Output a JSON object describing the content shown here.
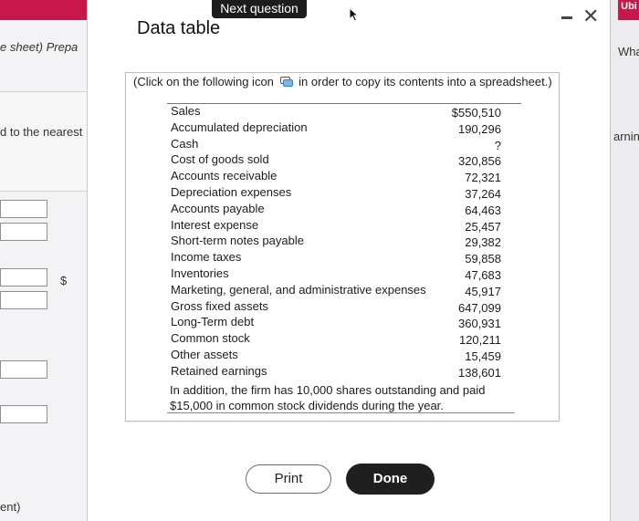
{
  "background": {
    "left_text_1": "e sheet) Prepa",
    "left_text_2": "d to the nearest",
    "left_dollar": "$",
    "left_text_3": "ent)",
    "right_text_1": "Wha",
    "right_text_2": "arnin",
    "right_badge": "Ubi"
  },
  "tooltip": "Next question",
  "window_title": "Data table",
  "window_controls": {
    "minimize": "minimize-icon",
    "close": "close-icon"
  },
  "instruction": {
    "before": "(Click on the following icon",
    "icon": "copy-icon",
    "after": "in order to copy its contents into a spreadsheet.)"
  },
  "table": {
    "rows": [
      {
        "label": "Sales",
        "value": "$550,510"
      },
      {
        "label": "Accumulated depreciation",
        "value": "190,296"
      },
      {
        "label": "Cash",
        "value": "?"
      },
      {
        "label": "Cost of goods sold",
        "value": "320,856"
      },
      {
        "label": "Accounts receivable",
        "value": "72,321"
      },
      {
        "label": "Depreciation expenses",
        "value": "37,264"
      },
      {
        "label": "Accounts payable",
        "value": "64,463"
      },
      {
        "label": "Interest expense",
        "value": "25,457"
      },
      {
        "label": "Short-term notes payable",
        "value": "29,382"
      },
      {
        "label": "Income taxes",
        "value": "59,858"
      },
      {
        "label": "Inventories",
        "value": "47,683"
      },
      {
        "label": "Marketing, general, and administrative expenses",
        "value": "45,917"
      },
      {
        "label": "Gross fixed assets",
        "value": "647,099"
      },
      {
        "label": "Long-Term debt",
        "value": "360,931"
      },
      {
        "label": "Common stock",
        "value": "120,211"
      },
      {
        "label": "Other assets",
        "value": "15,459"
      },
      {
        "label": "Retained earnings",
        "value": "138,601"
      }
    ],
    "footnote": "In addition, the firm has 10,000 shares outstanding and paid $15,000 in common stock dividends during the year."
  },
  "buttons": {
    "print": "Print",
    "done": "Done"
  },
  "colors": {
    "accent_red": "#c8174a",
    "done_bg": "#1f1f1f"
  }
}
